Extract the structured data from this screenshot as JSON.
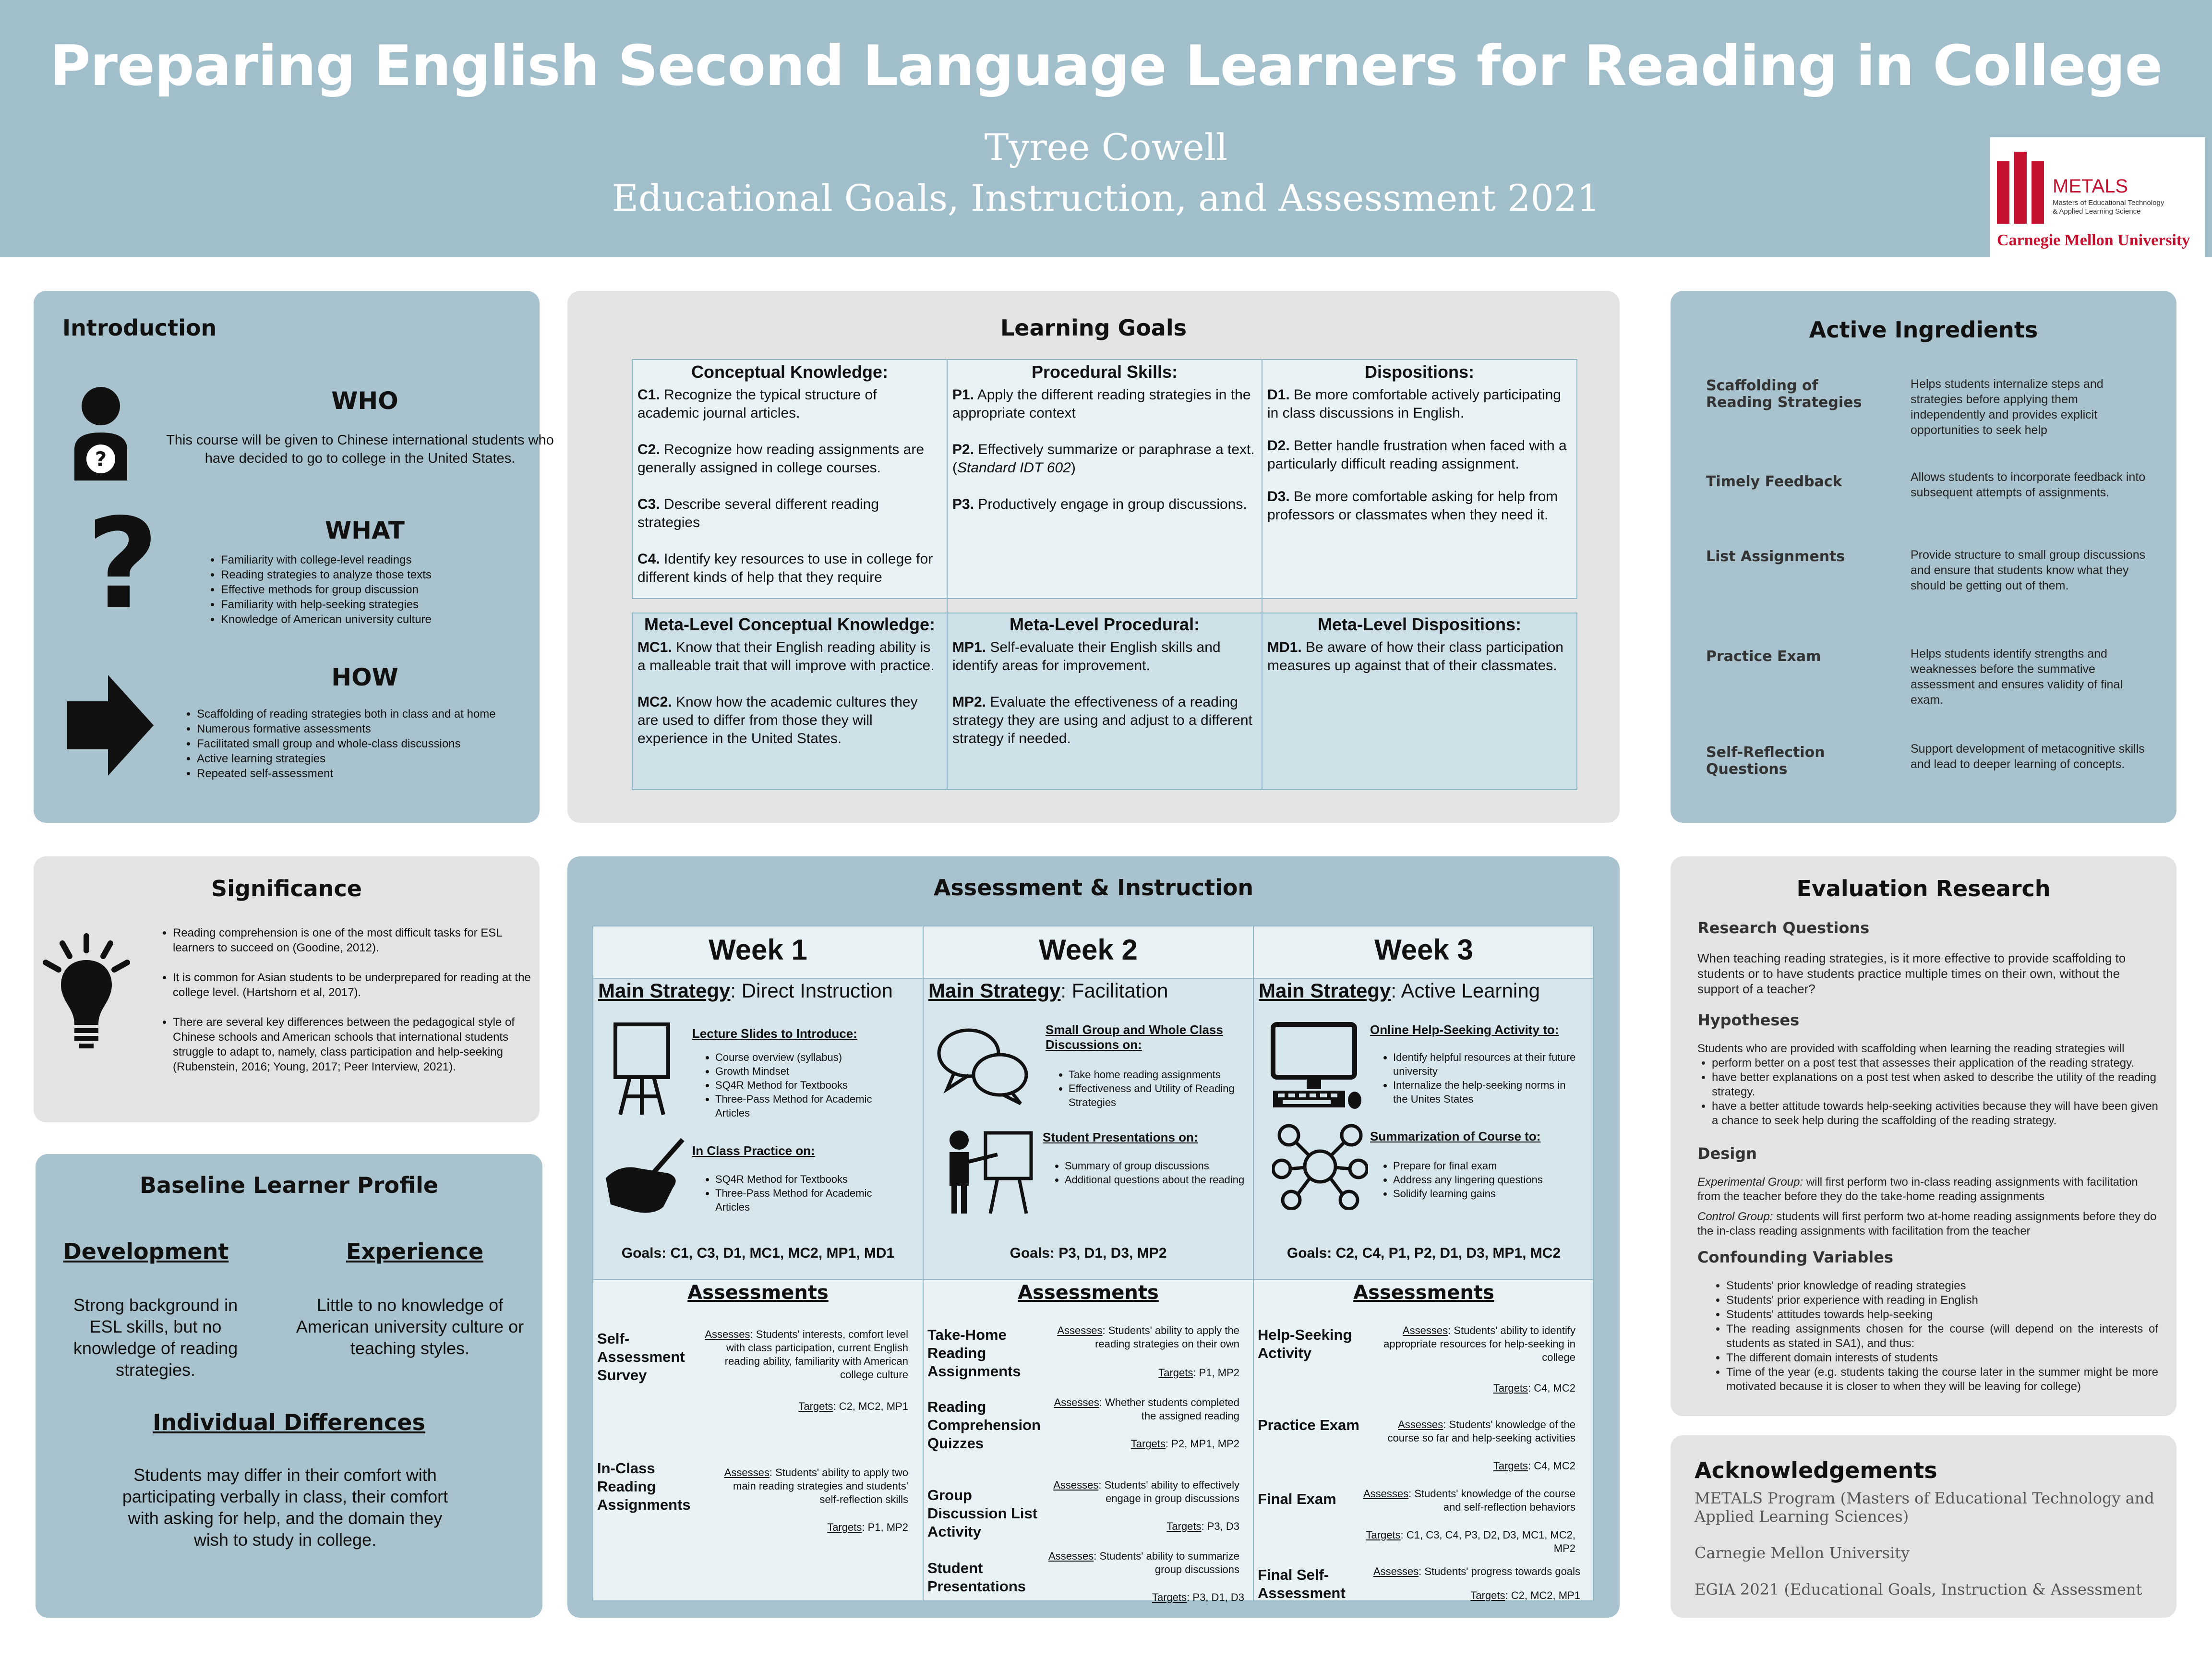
{
  "header": {
    "title": "Preparing English Second Language Learners for Reading in College",
    "author": "Tyree Cowell",
    "course": "Educational Goals, Instruction, and Assessment 2021",
    "logo_metals": "METALS",
    "logo_sub1": "Masters of Educational Technology",
    "logo_sub2": "& Applied Learning Science",
    "logo_cmu": "Carnegie Mellon University"
  },
  "introduction": {
    "title": "Introduction",
    "who_title": "WHO",
    "who_text": "This course will be given to Chinese international students who have decided to go to college in the United States.",
    "what_title": "WHAT",
    "what_items": [
      "Familiarity with college-level readings",
      "Reading strategies to analyze those texts",
      "Effective methods for group discussion",
      "Familiarity with help-seeking strategies",
      "Knowledge of American university culture"
    ],
    "how_title": "HOW",
    "how_items": [
      "Scaffolding of reading strategies both in class and at home",
      "Numerous formative assessments",
      "Facilitated small group and whole-class discussions",
      "Active learning strategies",
      "Repeated self-assessment"
    ]
  },
  "learning_goals": {
    "title": "Learning Goals",
    "cols": [
      {
        "head": "Conceptual Knowledge:",
        "items": [
          {
            "id": "C1.",
            "text": " Recognize the typical structure of academic journal articles."
          },
          {
            "id": "C2.",
            "text": " Recognize how reading assignments are generally assigned in college courses."
          },
          {
            "id": "C3.",
            "text": " Describe several different reading strategies"
          },
          {
            "id": "C4.",
            "text": " Identify key resources to use in college for different kinds of help that they require"
          }
        ]
      },
      {
        "head": "Procedural Skills:",
        "items": [
          {
            "id": "P1.",
            "text": " Apply the different reading strategies in the appropriate context"
          },
          {
            "id": "P2.",
            "text": " Effectively summarize or paraphrase a text. (",
            "em": "Standard IDT 602",
            "after": ")"
          },
          {
            "id": "P3.",
            "text": " Productively engage in group discussions."
          }
        ]
      },
      {
        "head": "Dispositions:",
        "items": [
          {
            "id": "D1.",
            "text": " Be more comfortable actively participating in class discussions in English."
          },
          {
            "id": "D2.",
            "text": " Better handle frustration when faced with a particularly difficult reading assignment."
          },
          {
            "id": "D3.",
            "text": " Be more comfortable asking for help from professors or classmates when they need it."
          }
        ]
      }
    ],
    "meta": [
      {
        "head": "Meta-Level Conceptual Knowledge:",
        "items": [
          {
            "id": "MC1.",
            "text": " Know that their English reading ability is a malleable trait that will improve with practice."
          },
          {
            "id": "MC2.",
            "text": " Know how the academic cultures they are used to differ from those they will experience in the United States."
          }
        ]
      },
      {
        "head": "Meta-Level Procedural:",
        "items": [
          {
            "id": "MP1.",
            "text": " Self-evaluate their English skills and identify areas for improvement."
          },
          {
            "id": "MP2.",
            "text": " Evaluate the effectiveness of a reading strategy they are using and adjust to a different strategy if needed."
          }
        ]
      },
      {
        "head": "Meta-Level Dispositions:",
        "items": [
          {
            "id": "MD1.",
            "text": " Be aware of how their class participation measures up against that of their classmates."
          }
        ]
      }
    ]
  },
  "active_ingredients": {
    "title": "Active Ingredients",
    "rows": [
      {
        "label": "Scaffolding of Reading Strategies",
        "desc": "Helps students internalize steps and strategies before applying them independently and provides explicit opportunities to seek help"
      },
      {
        "label": "Timely Feedback",
        "desc": "Allows students to incorporate feedback into subsequent attempts of assignments."
      },
      {
        "label": "List Assignments",
        "desc": "Provide structure to small group discussions and ensure that students know what they should be getting out of them."
      },
      {
        "label": "Practice Exam",
        "desc": "Helps students identify strengths and weaknesses before the summative assessment and ensures validity of final exam."
      },
      {
        "label": "Self-Reflection Questions",
        "desc": "Support development of metacognitive skills and lead to deeper learning of concepts."
      }
    ]
  },
  "significance": {
    "title": "Significance",
    "items": [
      "Reading comprehension is one of the most difficult tasks for ESL learners to succeed on (Goodine, 2012).",
      "It is common for Asian students to be underprepared for reading at the college level. (Hartshorn et al, 2017).",
      "There are several key differences between the pedagogical style of Chinese schools and American schools that international students struggle to adapt to, namely, class participation and help-seeking (Rubenstein, 2016; Young, 2017; Peer Interview, 2021)."
    ]
  },
  "baseline": {
    "title": "Baseline Learner Profile",
    "dev_title": "Development",
    "dev_text": "Strong background in ESL skills, but no knowledge of reading strategies.",
    "exp_title": "Experience",
    "exp_text": "Little to no knowledge of American university culture or teaching styles.",
    "ind_title": "Individual Differences",
    "ind_text": "Students may differ in their comfort with participating verbally in class, their comfort with asking for help, and the domain they wish to study in college."
  },
  "assessment_instruction": {
    "title": "Assessment & Instruction",
    "main_strategy_label": "Main Strategy",
    "assessments_label": "Assessments",
    "assesses_label": "Assesses",
    "targets_label": "Targets",
    "weeks": [
      {
        "name": "Week 1",
        "strategy": "Direct Instruction",
        "blocks": [
          {
            "head": "Lecture Slides to Introduce:",
            "items": [
              "Course overview (syllabus)",
              "Growth Mindset",
              "SQ4R Method for Textbooks",
              "Three-Pass Method for Academic Articles"
            ]
          },
          {
            "head": "In Class Practice on:",
            "items": [
              "SQ4R Method for Textbooks",
              "Three-Pass Method for Academic Articles"
            ]
          }
        ],
        "goals": "Goals: C1, C3, D1, MC1, MC2, MP1, MD1",
        "assessments": [
          {
            "name": "Self-Assessment Survey",
            "assesses": "Students' interests, comfort level with class participation, current English reading ability, familiarity with American college culture",
            "targets": "C2, MC2, MP1"
          },
          {
            "name": "In-Class Reading Assignments",
            "assesses": "Students' ability to apply two main reading strategies and students' self-reflection skills",
            "targets": "P1, MP2"
          }
        ]
      },
      {
        "name": "Week 2",
        "strategy": "Facilitation",
        "blocks": [
          {
            "head": "Small Group and Whole Class Discussions on:",
            "items": [
              "Take home reading assignments",
              "Effectiveness and Utility of Reading Strategies"
            ]
          },
          {
            "head": "Student Presentations on:",
            "items": [
              "Summary of group discussions",
              "Additional questions about the reading"
            ]
          }
        ],
        "goals": "Goals: P3, D1, D3, MP2",
        "assessments": [
          {
            "name": "Take-Home Reading Assignments",
            "assesses": "Students' ability to apply the reading strategies on their own",
            "targets": "P1, MP2"
          },
          {
            "name": "Reading Comprehension Quizzes",
            "assesses": "Whether students completed the assigned reading",
            "targets": "P2, MP1, MP2"
          },
          {
            "name": "Group Discussion List Activity",
            "assesses": "Students' ability to effectively engage in group discussions",
            "targets": "P3, D3"
          },
          {
            "name": "Student Presentations",
            "assesses": "Students' ability to summarize group discussions",
            "targets": "P3, D1, D3"
          }
        ]
      },
      {
        "name": "Week 3",
        "strategy": "Active Learning",
        "blocks": [
          {
            "head": "Online Help-Seeking Activity to:",
            "items": [
              "Identify helpful resources at their future university",
              "Internalize the help-seeking norms in the Unites States"
            ]
          },
          {
            "head": "Summarization of Course to:",
            "items": [
              "Prepare for final exam",
              "Address any lingering questions",
              "Solidify learning gains"
            ]
          }
        ],
        "goals": "Goals: C2, C4, P1, P2, D1, D3, MP1, MC2",
        "assessments": [
          {
            "name": "Help-Seeking Activity",
            "assesses": "Students' ability to identify appropriate resources for help-seeking in college",
            "targets": "C4, MC2"
          },
          {
            "name": "Practice Exam",
            "assesses": "Students' knowledge of the course so far and help-seeking activities",
            "targets": "C4, MC2"
          },
          {
            "name": "Final Exam",
            "assesses": "Students' knowledge of the course and self-reflection behaviors",
            "targets": "C1, C3, C4, P3, D2, D3, MC1, MC2, MP2"
          },
          {
            "name": "Final Self-Assessment",
            "assesses": "Students' progress towards goals",
            "targets": "C2, MC2, MP1"
          }
        ]
      }
    ]
  },
  "evaluation": {
    "title": "Evaluation Research",
    "rq_title": "Research Questions",
    "rq_text": "When teaching reading strategies, is it more effective to provide scaffolding to students or to have students practice multiple times on their own, without the support of a teacher?",
    "hyp_title": "Hypotheses",
    "hyp_intro": "Students who are provided with scaffolding when learning the reading strategies will",
    "hyp_items": [
      "perform better on a post test that assesses their application of the reading strategy.",
      "have better explanations on a post test when asked to describe the utility of the reading strategy.",
      "have a better attitude towards help-seeking activities because they will have been given a chance to seek help during the scaffolding of the reading strategy."
    ],
    "design_title": "Design",
    "design_exp_label": "Experimental Group:",
    "design_exp": " will first perform two in-class reading assignments with facilitation from the teacher before they do the take-home reading assignments",
    "design_ctl_label": "Control Group:",
    "design_ctl": " students will first perform two at-home reading assignments before they do the in-class reading assignments with facilitation from the teacher",
    "conf_title": "Confounding Variables",
    "conf_items": [
      "Students' prior knowledge of reading strategies",
      "Students' prior experience with reading in English",
      "Students' attitudes towards help-seeking",
      "The reading assignments chosen for the course (will depend on the interests of students as stated in SA1), and thus:",
      "The different domain interests of students",
      "Time of the year (e.g. students taking the course later in the summer might be more motivated because it is closer to when they will be leaving for college)"
    ]
  },
  "acknowledgements": {
    "title": "Acknowledgements",
    "items": [
      "METALS Program (Masters of Educational Technology and Applied Learning Sciences)",
      "Carnegie Mellon University",
      "EGIA 2021 (Educational Goals, Instruction & Assessment"
    ]
  }
}
